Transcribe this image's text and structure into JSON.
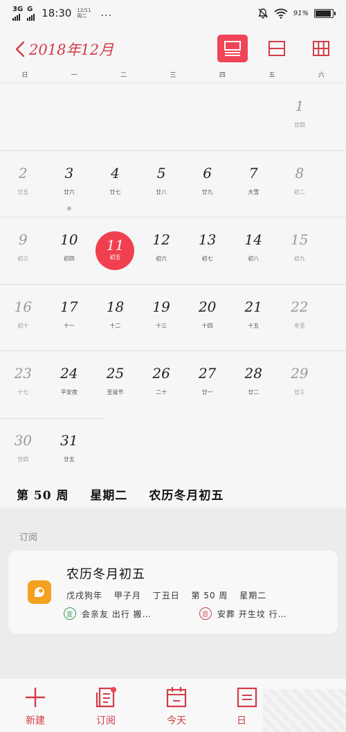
{
  "status": {
    "network": [
      "3G",
      "G"
    ],
    "time": "18:30",
    "date": "12/11",
    "weekday": "周二",
    "dots": "...",
    "battery_text": "91%",
    "battery_level": 0.91
  },
  "header": {
    "title": "2018年12月",
    "views": [
      "month-list-icon",
      "week-view-icon",
      "grid-view-icon"
    ]
  },
  "weekdays": [
    "日",
    "一",
    "二",
    "三",
    "四",
    "五",
    "六"
  ],
  "weeks": [
    [
      null,
      null,
      null,
      null,
      null,
      null,
      {
        "d": "1",
        "l": "廿四",
        "weekend": true
      }
    ],
    [
      {
        "d": "2",
        "l": "廿五",
        "weekend": true
      },
      {
        "d": "3",
        "l": "廿六",
        "dot": true
      },
      {
        "d": "4",
        "l": "廿七"
      },
      {
        "d": "5",
        "l": "廿八"
      },
      {
        "d": "6",
        "l": "廿九"
      },
      {
        "d": "7",
        "l": "大雪"
      },
      {
        "d": "8",
        "l": "初二",
        "weekend": true
      }
    ],
    [
      {
        "d": "9",
        "l": "初三",
        "weekend": true
      },
      {
        "d": "10",
        "l": "初四"
      },
      {
        "d": "11",
        "l": "初五",
        "today": true
      },
      {
        "d": "12",
        "l": "初六"
      },
      {
        "d": "13",
        "l": "初七"
      },
      {
        "d": "14",
        "l": "初八"
      },
      {
        "d": "15",
        "l": "初九",
        "weekend": true
      }
    ],
    [
      {
        "d": "16",
        "l": "初十",
        "weekend": true
      },
      {
        "d": "17",
        "l": "十一"
      },
      {
        "d": "18",
        "l": "十二"
      },
      {
        "d": "19",
        "l": "十三"
      },
      {
        "d": "20",
        "l": "十四"
      },
      {
        "d": "21",
        "l": "十五"
      },
      {
        "d": "22",
        "l": "冬至",
        "weekend": true
      }
    ],
    [
      {
        "d": "23",
        "l": "十七",
        "weekend": true
      },
      {
        "d": "24",
        "l": "平安夜"
      },
      {
        "d": "25",
        "l": "圣诞节"
      },
      {
        "d": "26",
        "l": "二十"
      },
      {
        "d": "27",
        "l": "廿一"
      },
      {
        "d": "28",
        "l": "廿二"
      },
      {
        "d": "29",
        "l": "廿三",
        "weekend": true
      }
    ],
    [
      {
        "d": "30",
        "l": "廿四",
        "weekend": true
      },
      {
        "d": "31",
        "l": "廿五"
      },
      null,
      null,
      null,
      null,
      null
    ]
  ],
  "info": {
    "week": "第 50 周",
    "day": "星期二",
    "lunar": "农历冬月初五"
  },
  "subscription": {
    "section_title": "订阅",
    "card_title": "农历冬月初五",
    "ganzhi": [
      "戊戌狗年",
      "甲子月",
      "丁丑日",
      "第 50 周",
      "星期二"
    ],
    "yi_badge": "宜",
    "yi_text": "会亲友 出行 搬…",
    "ji_badge": "忌",
    "ji_text": "安葬 开生坟 行…"
  },
  "tabs": [
    {
      "label": "新建",
      "icon": "plus-icon"
    },
    {
      "label": "订阅",
      "icon": "subscription-icon"
    },
    {
      "label": "今天",
      "icon": "calendar-today-icon"
    },
    {
      "label": "日",
      "icon": "day-view-icon"
    }
  ],
  "colors": {
    "accent": "#f04457",
    "text_red": "#d33b47",
    "card_icon": "#f4a020"
  }
}
